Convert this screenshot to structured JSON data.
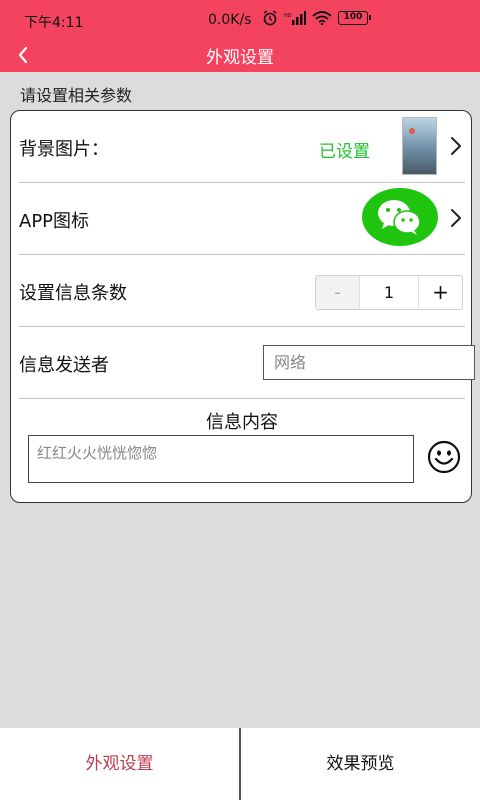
{
  "status_bar": {
    "time": "下午4:11",
    "speed": "0.0K/s",
    "battery": "100"
  },
  "header": {
    "title": "外观设置",
    "bg_color": "#f4435f"
  },
  "section": {
    "title": "请设置相关参数"
  },
  "rows": {
    "background": {
      "label": "背景图片：",
      "status": "已设置"
    },
    "app_icon": {
      "label": "APP图标"
    },
    "message_count": {
      "label": "设置信息条数",
      "value": "1",
      "minus": "-",
      "plus": "+"
    },
    "sender": {
      "label": "信息发送者",
      "placeholder": "网络"
    }
  },
  "content": {
    "title": "信息内容",
    "placeholder": "红红火火恍恍惚惚"
  },
  "tabs": [
    {
      "label": "外观设置",
      "active": true
    },
    {
      "label": "效果预览",
      "active": false
    }
  ],
  "colors": {
    "accent": "#f4435f",
    "status_green": "#21c32b",
    "wechat_green": "#1fc40f",
    "active_tab": "#c03d4f"
  }
}
